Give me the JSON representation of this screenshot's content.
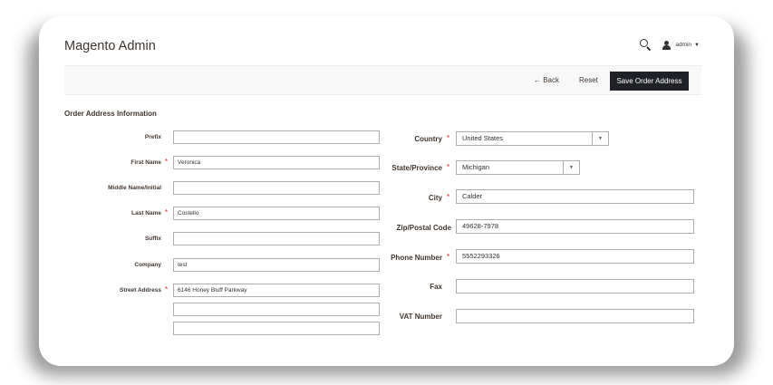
{
  "header": {
    "title": "Magento Admin",
    "user": "admin"
  },
  "actions": {
    "back": "← Back",
    "reset": "Reset",
    "save": "Save Order Address"
  },
  "section_title": "Order Address Information",
  "left_fields": {
    "prefix": {
      "label": "Prefix",
      "value": ""
    },
    "first_name": {
      "label": "First Name",
      "value": "Veronica"
    },
    "middle_name": {
      "label": "Middle Name/Initial",
      "value": ""
    },
    "last_name": {
      "label": "Last Name",
      "value": "Costello"
    },
    "suffix": {
      "label": "Suffix",
      "value": ""
    },
    "company": {
      "label": "Company",
      "value": "test"
    },
    "street": {
      "label": "Street Address",
      "line1": "6146 Honey Bluff Parkway",
      "line2": "",
      "line3": ""
    }
  },
  "right_fields": {
    "country": {
      "label": "Country",
      "value": "United States"
    },
    "state": {
      "label": "State/Province",
      "value": "Michigan"
    },
    "city": {
      "label": "City",
      "value": "Calder"
    },
    "zip": {
      "label": "Zip/Postal Code",
      "value": "49628-7978"
    },
    "phone": {
      "label": "Phone Number",
      "value": "5552293326"
    },
    "fax": {
      "label": "Fax",
      "value": ""
    },
    "vat": {
      "label": "VAT Number",
      "value": ""
    }
  },
  "required_marker": "*",
  "colors": {
    "primary_button": "#1f2126",
    "required": "#e22626",
    "text": "#41362f",
    "border": "#adadad"
  }
}
